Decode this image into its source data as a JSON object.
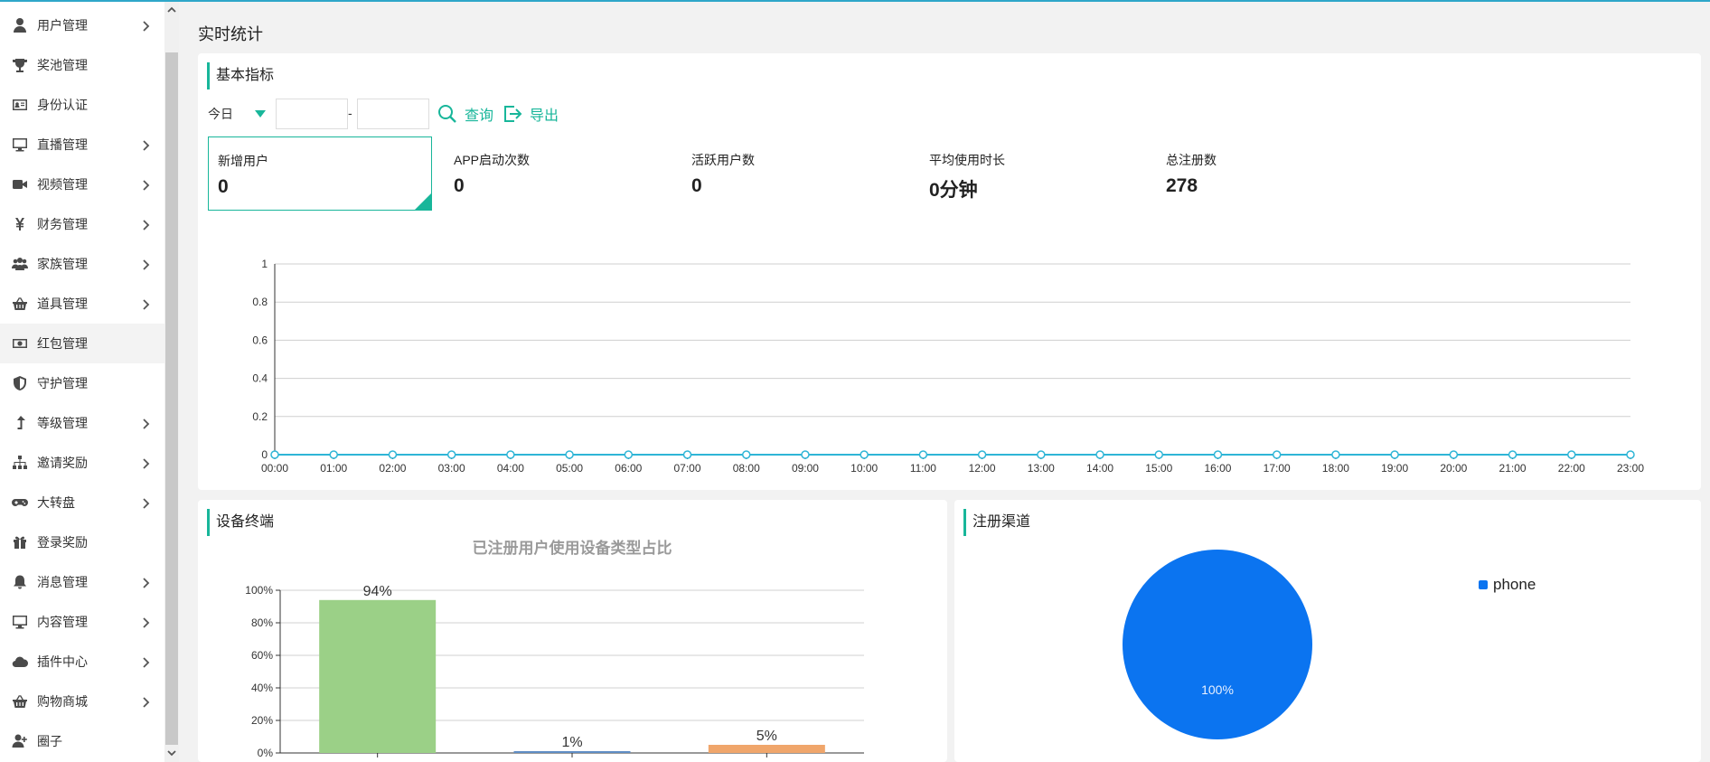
{
  "sidebar": {
    "items": [
      {
        "label": "用户管理",
        "icon": "user-icon",
        "chevron": true,
        "active": false
      },
      {
        "label": "奖池管理",
        "icon": "trophy-icon",
        "chevron": false,
        "active": false
      },
      {
        "label": "身份认证",
        "icon": "id-card-icon",
        "chevron": false,
        "active": false
      },
      {
        "label": "直播管理",
        "icon": "monitor-icon",
        "chevron": true,
        "active": false
      },
      {
        "label": "视频管理",
        "icon": "video-camera-icon",
        "chevron": true,
        "active": false
      },
      {
        "label": "财务管理",
        "icon": "yen-icon",
        "chevron": true,
        "active": false
      },
      {
        "label": "家族管理",
        "icon": "users-icon",
        "chevron": true,
        "active": false
      },
      {
        "label": "道具管理",
        "icon": "basket-icon",
        "chevron": true,
        "active": false
      },
      {
        "label": "红包管理",
        "icon": "money-icon",
        "chevron": false,
        "active": true
      },
      {
        "label": "守护管理",
        "icon": "shield-icon",
        "chevron": false,
        "active": false
      },
      {
        "label": "等级管理",
        "icon": "level-up-icon",
        "chevron": true,
        "active": false
      },
      {
        "label": "邀请奖励",
        "icon": "sitemap-icon",
        "chevron": true,
        "active": false
      },
      {
        "label": "大转盘",
        "icon": "gamepad-icon",
        "chevron": true,
        "active": false
      },
      {
        "label": "登录奖励",
        "icon": "gift-icon",
        "chevron": false,
        "active": false
      },
      {
        "label": "消息管理",
        "icon": "bell-icon",
        "chevron": true,
        "active": false
      },
      {
        "label": "内容管理",
        "icon": "monitor-icon",
        "chevron": true,
        "active": false
      },
      {
        "label": "插件中心",
        "icon": "cloud-icon",
        "chevron": true,
        "active": false
      },
      {
        "label": "购物商城",
        "icon": "basket-icon",
        "chevron": true,
        "active": false
      },
      {
        "label": "圈子",
        "icon": "user-plus-icon",
        "chevron": false,
        "active": false
      }
    ]
  },
  "page": {
    "title": "实时统计"
  },
  "basic": {
    "title": "基本指标",
    "filter": {
      "range": "今日",
      "start": "",
      "end": "",
      "separator": "-"
    },
    "search_label": "查询",
    "export_label": "导出",
    "kpis": [
      {
        "label": "新增用户",
        "value": "0",
        "selected": true
      },
      {
        "label": "APP启动次数",
        "value": "0",
        "selected": false
      },
      {
        "label": "活跃用户数",
        "value": "0",
        "selected": false
      },
      {
        "label": "平均使用时长",
        "value": "0分钟",
        "selected": false
      },
      {
        "label": "总注册数",
        "value": "278",
        "selected": false
      }
    ]
  },
  "device": {
    "title": "设备终端"
  },
  "channel": {
    "title": "注册渠道"
  },
  "colors": {
    "accent": "#18b69a",
    "line": "#2fb5d6",
    "bar1": "#9bd087",
    "bar2": "#5f8dc4",
    "bar3": "#f0a66b",
    "pie": "#0b74f0"
  },
  "chart_data": [
    {
      "type": "line",
      "title": "",
      "x": [
        "00:00",
        "01:00",
        "02:00",
        "03:00",
        "04:00",
        "05:00",
        "06:00",
        "07:00",
        "08:00",
        "09:00",
        "10:00",
        "11:00",
        "12:00",
        "13:00",
        "14:00",
        "15:00",
        "16:00",
        "17:00",
        "18:00",
        "19:00",
        "20:00",
        "21:00",
        "22:00",
        "23:00"
      ],
      "series": [
        {
          "values": [
            0,
            0,
            0,
            0,
            0,
            0,
            0,
            0,
            0,
            0,
            0,
            0,
            0,
            0,
            0,
            0,
            0,
            0,
            0,
            0,
            0,
            0,
            0,
            0
          ]
        }
      ],
      "ylim": [
        0,
        1
      ],
      "yticks": [
        "0",
        "0.2",
        "0.4",
        "0.6",
        "0.8",
        "1"
      ],
      "grid": true
    },
    {
      "type": "bar",
      "title": "已注册用户使用设备类型占比",
      "values": [
        94,
        1,
        5
      ],
      "labels": [
        "94%",
        "1%",
        "5%"
      ],
      "ylim": [
        0,
        100
      ],
      "yticks": [
        "0%",
        "20%",
        "40%",
        "60%",
        "80%",
        "100%"
      ],
      "grid": true
    },
    {
      "type": "pie",
      "slices": [
        {
          "name": "phone",
          "value": 100,
          "label": "100%"
        }
      ],
      "legend_position": "top-right"
    }
  ]
}
